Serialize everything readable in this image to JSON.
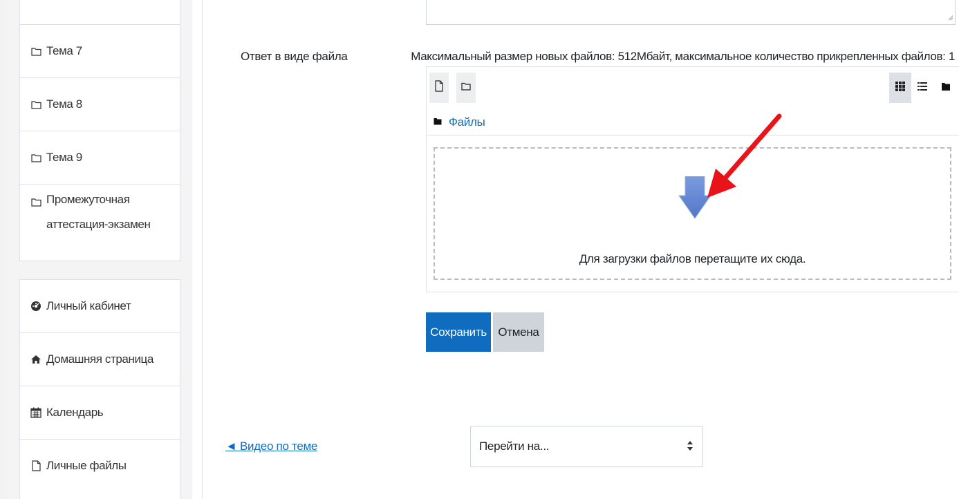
{
  "sidebar": {
    "sections": [
      {
        "label": "Тема 7",
        "icon": "folder-icon"
      },
      {
        "label": "Тема 8",
        "icon": "folder-icon"
      },
      {
        "label": "Тема 9",
        "icon": "folder-icon"
      },
      {
        "label_line1": "Промежуточная",
        "label_line2": "аттестация-экзамен",
        "icon": "folder-icon"
      }
    ],
    "nav": [
      {
        "label": "Личный кабинет",
        "icon": "dashboard-icon"
      },
      {
        "label": "Домашняя страница",
        "icon": "home-icon"
      },
      {
        "label": "Календарь",
        "icon": "calendar-icon"
      },
      {
        "label": "Личные файлы",
        "icon": "file-icon"
      }
    ]
  },
  "form": {
    "file_label": "Ответ в виде файла",
    "limits": "Максимальный размер новых файлов: 512Мбайт, максимальное количество прикрепленных файлов: 1",
    "filemanager": {
      "path_label": "Файлы",
      "dropzone_text": "Для загрузки файлов перетащите их сюда."
    },
    "save_label": "Сохранить",
    "cancel_label": "Отмена"
  },
  "footer": {
    "prev_link": "◄ Видео по теме",
    "jump_placeholder": "Перейти на..."
  },
  "colors": {
    "primary": "#0f6cbf",
    "annotation_arrow": "#e8141a",
    "upload_arrow": "#6b8fd6"
  }
}
